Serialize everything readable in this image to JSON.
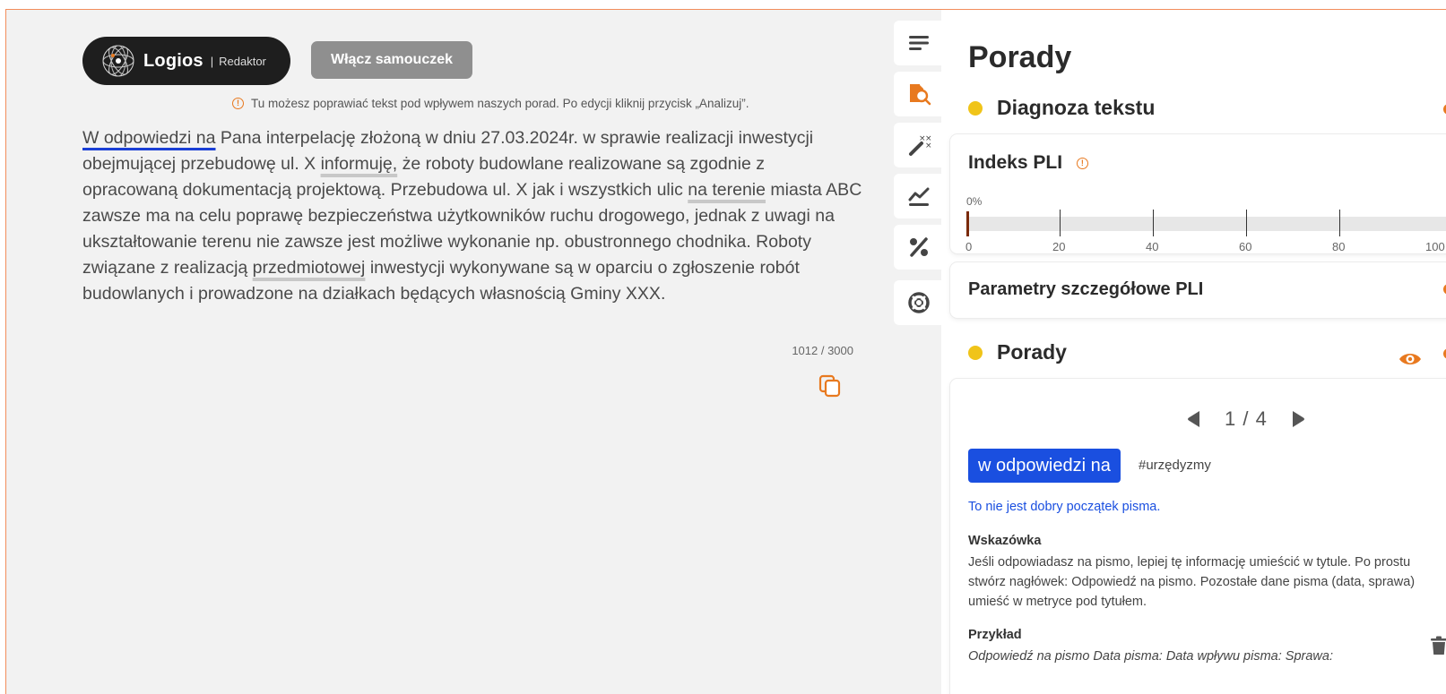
{
  "brand": {
    "name": "Logios",
    "separator": "|",
    "subtitle": "Redaktor"
  },
  "tutorial_button": "Włącz samouczek",
  "hint": "Tu możesz poprawiać tekst pod wpływem naszych porad. Po edycji kliknij przycisk „Analizuj”.",
  "editor": {
    "segments": [
      {
        "text": "W odpowiedzi na",
        "mark": "blue"
      },
      {
        "text": " Pana interpelację złożoną w dniu 27.03.2024r. w sprawie realizacji inwestycji obejmującej przebudowę ul. X ",
        "mark": ""
      },
      {
        "text": "informuję,",
        "mark": "grey"
      },
      {
        "text": " że roboty budowlane realizowane są zgodnie z opracowaną dokumentacją projektową. Przebudowa ul. X jak i wszystkich ulic ",
        "mark": ""
      },
      {
        "text": "na terenie",
        "mark": "grey"
      },
      {
        "text": " miasta ABC zawsze ma na celu poprawę bezpieczeństwa użytkowników ruchu drogowego, jednak z uwagi na ukształtowanie terenu nie zawsze jest możliwe wykonanie np. obustronnego chodnika. Roboty związane z realizacją ",
        "mark": ""
      },
      {
        "text": "przedmiotowej",
        "mark": "grey"
      },
      {
        "text": " inwestycji wykonywane są w oparciu o zgłoszenie robót budowlanych i prowadzone na działkach będących własnością Gminy XXX.",
        "mark": ""
      }
    ],
    "counter": "1012 / 3000"
  },
  "toolbar": {
    "icons": [
      "text-align-icon",
      "search-document-icon",
      "magic-wand-icon",
      "chart-line-icon",
      "percent-icon",
      "lifebuoy-icon"
    ]
  },
  "panel": {
    "title": "Porady",
    "diagnosis": "Diagnoza tekstu",
    "pli": {
      "title": "Indeks PLI",
      "value_label": "0%",
      "value": 0,
      "ticks": [
        "0",
        "20",
        "40",
        "60",
        "80",
        "100"
      ]
    },
    "params_title": "Parametry szczegółowe PLI",
    "advice_title": "Porady",
    "pager": "1 / 4",
    "phrase": "w odpowiedzi na",
    "tag": "#urzędyzmy",
    "advice_line": "To nie jest dobry początek pisma.",
    "tip_head": "Wskazówka",
    "tip_body": "Jeśli odpowiadasz na pismo, lepiej tę informację umieścić w tytule. Po prostu stwórz nagłówek: Odpowiedź na pismo. Pozostałe dane pisma (data, sprawa) umieść w metryce pod tytułem.",
    "example_head": "Przykład",
    "example_body": "Odpowiedź na pismo Data pisma: Data wpływu pisma: Sprawa:"
  },
  "colors": {
    "accent": "#e8791f",
    "highlight_blue": "#1a4fe0",
    "status_yellow": "#f0c419",
    "frame": "#f28d5c"
  }
}
